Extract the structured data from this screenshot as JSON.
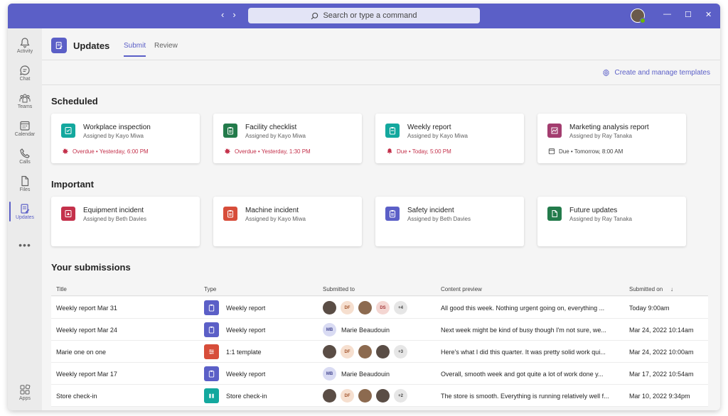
{
  "titlebar": {
    "search_placeholder": "Search or type a command",
    "back": "‹",
    "forward": "›",
    "minimize": "—",
    "maximize": "☐",
    "close": "✕"
  },
  "rail": {
    "items": [
      {
        "label": "Activity",
        "icon": "bell-icon"
      },
      {
        "label": "Chat",
        "icon": "chat-icon"
      },
      {
        "label": "Teams",
        "icon": "teams-icon"
      },
      {
        "label": "Calendar",
        "icon": "calendar-icon"
      },
      {
        "label": "Calls",
        "icon": "phone-icon"
      },
      {
        "label": "Files",
        "icon": "file-icon"
      },
      {
        "label": "Updates",
        "icon": "updates-icon"
      }
    ],
    "more": "•••",
    "apps_label": "Apps"
  },
  "app": {
    "title": "Updates",
    "tabs": [
      {
        "label": "Submit"
      },
      {
        "label": "Review"
      }
    ],
    "manage_templates": "Create and manage templates"
  },
  "scheduled": {
    "title": "Scheduled",
    "cards": [
      {
        "title": "Workplace inspection",
        "assigned": "Assigned by Kayo Miwa",
        "status": "Overdue • Yesterday, 6:00 PM",
        "color": "#13a89e",
        "status_type": "overdue"
      },
      {
        "title": "Facility checklist",
        "assigned": "Assigned by Kayo Miwa",
        "status": "Overdue • Yesterday, 1:30 PM",
        "color": "#237b4b",
        "status_type": "overdue"
      },
      {
        "title": "Weekly report",
        "assigned": "Assigned by Kayo Miwa",
        "status": "Due • Today, 5:00 PM",
        "color": "#13a89e",
        "status_type": "due"
      },
      {
        "title": "Marketing analysis report",
        "assigned": "Assigned by Ray Tanaka",
        "status": "Due • Tomorrow, 8:00 AM",
        "color": "#a33d6f",
        "status_type": "calendar"
      }
    ]
  },
  "important": {
    "title": "Important",
    "cards": [
      {
        "title": "Equipment incident",
        "assigned": "Assigned by Beth Davies",
        "color": "#c4314b"
      },
      {
        "title": "Machine incident",
        "assigned": "Assigned by Kayo Miwa",
        "color": "#d74d3a"
      },
      {
        "title": "Safety incident",
        "assigned": "Assigned by Beth Davies",
        "color": "#5b5fc7"
      },
      {
        "title": "Future updates",
        "assigned": "Assigned by Ray Tanaka",
        "color": "#237b4b"
      }
    ]
  },
  "submissions": {
    "title": "Your submissions",
    "columns": {
      "title": "Title",
      "type": "Type",
      "submitted_to": "Submitted to",
      "preview": "Content preview",
      "submitted_on": "Submitted on",
      "sort_icon": "↓"
    },
    "rows": [
      {
        "title": "Weekly report Mar 31",
        "type": "Weekly report",
        "type_color": "#5b5fc7",
        "recipients": [
          "photo",
          "DF",
          "photo2",
          "DS"
        ],
        "more": "+4",
        "preview": "All good this week. Nothing urgent going on, everything ...",
        "date": "Today 9:00am"
      },
      {
        "title": "Weekly report Mar 24",
        "type": "Weekly report",
        "type_color": "#5b5fc7",
        "recipients": [
          "MB"
        ],
        "name": "Marie Beaudouin",
        "preview": "Next week might be kind of busy though I'm not sure, we...",
        "date": "Mar 24, 2022 10:14am"
      },
      {
        "title": "Marie one on one",
        "type": "1:1 template",
        "type_color": "#d74d3a",
        "recipients": [
          "photo",
          "DF",
          "photo2",
          "photo"
        ],
        "more": "+3",
        "preview": "Here's what I did this quarter. It was pretty solid work qui...",
        "date": "Mar 24, 2022 10:00am"
      },
      {
        "title": "Weekly report Mar 17",
        "type": "Weekly report",
        "type_color": "#5b5fc7",
        "recipients": [
          "MB"
        ],
        "name": "Marie Beaudouin",
        "preview": "Overall, smooth week and got quite a lot of work done y...",
        "date": "Mar 17, 2022 10:54am"
      },
      {
        "title": "Store check-in",
        "type": "Store check-in",
        "type_color": "#13a89e",
        "recipients": [
          "photo",
          "DF",
          "photo2",
          "photo"
        ],
        "more": "+2",
        "preview": "The store is smooth. Everything is running relatively well f...",
        "date": "Mar 10, 2022 9:34pm"
      }
    ]
  }
}
